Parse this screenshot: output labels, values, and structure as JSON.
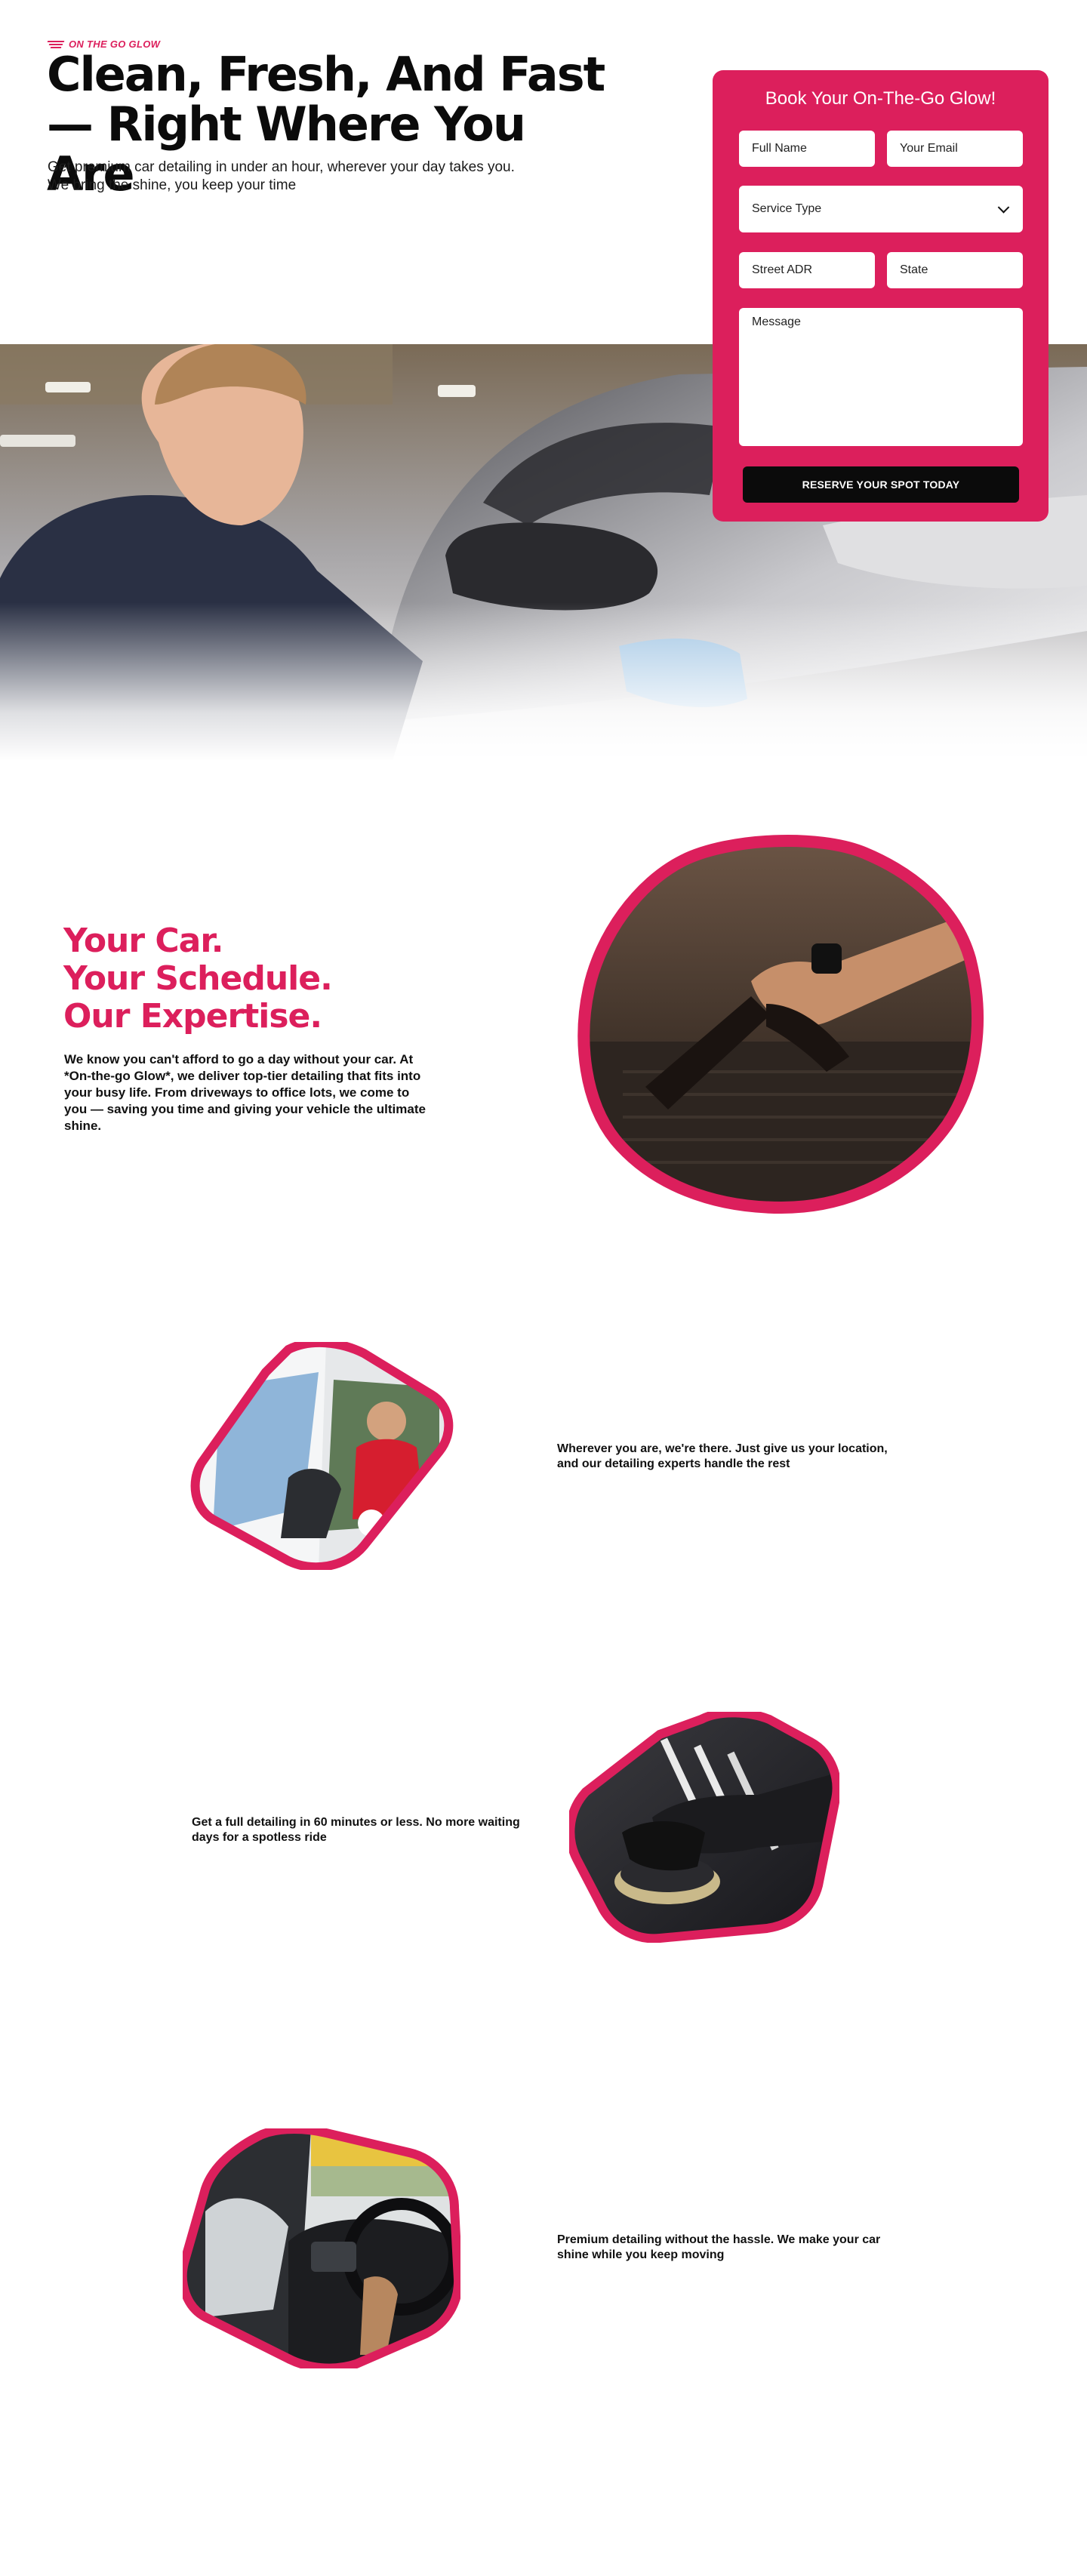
{
  "brand": {
    "name": "ON THE GO GLOW",
    "accent": "#dc1f5c"
  },
  "hero": {
    "title": "Clean, Fresh, And Fast — Right Where You Are",
    "subtitle": "Get premium car detailing in under an hour, wherever your day takes you. We bring the shine, you keep your time",
    "image": "detailer-polishing-car-photo"
  },
  "booking": {
    "title": "Book Your On-The-Go Glow!",
    "fields": {
      "full_name": "Full Name",
      "email": "Your Email",
      "service_type": "Service Type",
      "street": "Street ADR",
      "state": "State",
      "message": "Message"
    },
    "submit": "RESERVE YOUR SPOT TODAY"
  },
  "intro": {
    "title_lines": [
      "Your Car.",
      "Your Schedule.",
      "Our Expertise."
    ],
    "body": "We know you can't afford to go a day without your car. At *On-the-go Glow*, we deliver top-tier detailing that fits into your busy life. From driveways to office lots, we come to you — saving you time and giving your vehicle the ultimate shine.",
    "image": "interior-vacuum-photo"
  },
  "features": [
    {
      "text": "Wherever you are, we're there. Just give us your location, and our detailing experts handle the rest",
      "image": "detailer-in-van-photo"
    },
    {
      "text": "Get a full detailing in 60 minutes or less. No more waiting days for a spotless ride",
      "image": "polisher-buffing-photo"
    },
    {
      "text": "Premium detailing without the hassle. We make your car shine while you keep moving",
      "image": "driver-dashboard-photo"
    }
  ]
}
